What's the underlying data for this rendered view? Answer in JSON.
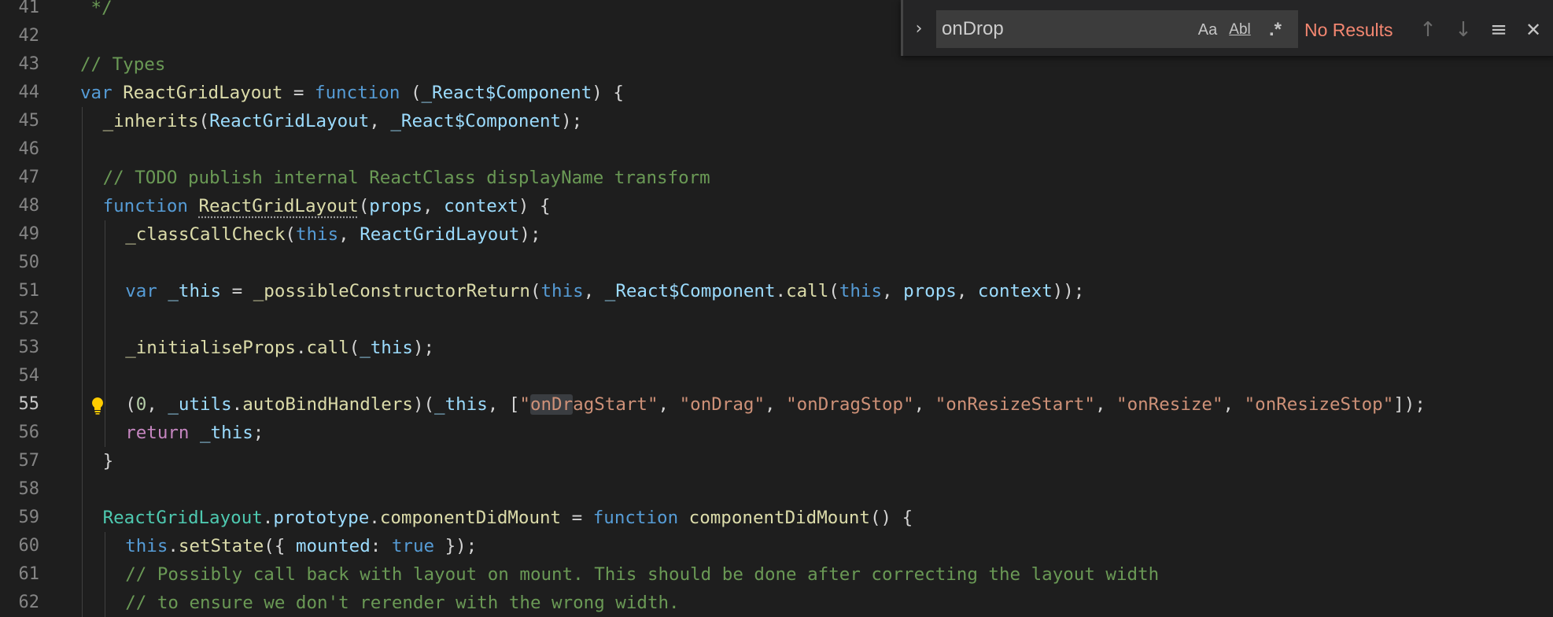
{
  "find_widget": {
    "expand_label": "›",
    "query": "onDrop",
    "match_case_label": "Aa",
    "whole_word_label": "Abl",
    "regex_label": ".*",
    "result_text": "No Results",
    "prev_label": "↑",
    "next_label": "↓",
    "selection_label": "≡",
    "close_label": "✕"
  },
  "editor": {
    "active_line": 55,
    "lines": [
      {
        "num": "41",
        "indent": 0,
        "tokens": [
          {
            "t": " */",
            "c": "comment"
          }
        ]
      },
      {
        "num": "42",
        "indent": 0,
        "tokens": []
      },
      {
        "num": "43",
        "indent": 0,
        "tokens": [
          {
            "t": "// Types",
            "c": "comment"
          }
        ]
      },
      {
        "num": "44",
        "indent": 0,
        "tokens": [
          {
            "t": "var ",
            "c": "keyword"
          },
          {
            "t": "ReactGridLayout",
            "c": "func"
          },
          {
            "t": " = ",
            "c": "plain"
          },
          {
            "t": "function",
            "c": "keyword"
          },
          {
            "t": " (",
            "c": "plain"
          },
          {
            "t": "_React$Component",
            "c": "var"
          },
          {
            "t": ") {",
            "c": "plain"
          }
        ]
      },
      {
        "num": "45",
        "indent": 1,
        "tokens": [
          {
            "t": "_inherits",
            "c": "func"
          },
          {
            "t": "(",
            "c": "plain"
          },
          {
            "t": "ReactGridLayout",
            "c": "var"
          },
          {
            "t": ", ",
            "c": "plain"
          },
          {
            "t": "_React$Component",
            "c": "var"
          },
          {
            "t": ");",
            "c": "plain"
          }
        ]
      },
      {
        "num": "46",
        "indent": 1,
        "tokens": []
      },
      {
        "num": "47",
        "indent": 1,
        "tokens": [
          {
            "t": "// TODO publish internal ReactClass displayName transform",
            "c": "comment"
          }
        ]
      },
      {
        "num": "48",
        "indent": 1,
        "tokens": [
          {
            "t": "function ",
            "c": "keyword"
          },
          {
            "t": "ReactGridLayout",
            "c": "func dotted"
          },
          {
            "t": "(",
            "c": "plain"
          },
          {
            "t": "props",
            "c": "var"
          },
          {
            "t": ", ",
            "c": "plain"
          },
          {
            "t": "context",
            "c": "var"
          },
          {
            "t": ") {",
            "c": "plain"
          }
        ]
      },
      {
        "num": "49",
        "indent": 2,
        "tokens": [
          {
            "t": "_classCallCheck",
            "c": "func"
          },
          {
            "t": "(",
            "c": "plain"
          },
          {
            "t": "this",
            "c": "keyword"
          },
          {
            "t": ", ",
            "c": "plain"
          },
          {
            "t": "ReactGridLayout",
            "c": "var"
          },
          {
            "t": ");",
            "c": "plain"
          }
        ]
      },
      {
        "num": "50",
        "indent": 2,
        "tokens": []
      },
      {
        "num": "51",
        "indent": 2,
        "tokens": [
          {
            "t": "var ",
            "c": "keyword"
          },
          {
            "t": "_this",
            "c": "var"
          },
          {
            "t": " = ",
            "c": "plain"
          },
          {
            "t": "_possibleConstructorReturn",
            "c": "func"
          },
          {
            "t": "(",
            "c": "plain"
          },
          {
            "t": "this",
            "c": "keyword"
          },
          {
            "t": ", ",
            "c": "plain"
          },
          {
            "t": "_React$Component",
            "c": "var"
          },
          {
            "t": ".",
            "c": "plain"
          },
          {
            "t": "call",
            "c": "func"
          },
          {
            "t": "(",
            "c": "plain"
          },
          {
            "t": "this",
            "c": "keyword"
          },
          {
            "t": ", ",
            "c": "plain"
          },
          {
            "t": "props",
            "c": "var"
          },
          {
            "t": ", ",
            "c": "plain"
          },
          {
            "t": "context",
            "c": "var"
          },
          {
            "t": "));",
            "c": "plain"
          }
        ]
      },
      {
        "num": "52",
        "indent": 2,
        "tokens": []
      },
      {
        "num": "53",
        "indent": 2,
        "tokens": [
          {
            "t": "_initialiseProps",
            "c": "func"
          },
          {
            "t": ".",
            "c": "plain"
          },
          {
            "t": "call",
            "c": "func"
          },
          {
            "t": "(",
            "c": "plain"
          },
          {
            "t": "_this",
            "c": "var"
          },
          {
            "t": ");",
            "c": "plain"
          }
        ]
      },
      {
        "num": "54",
        "indent": 2,
        "tokens": []
      },
      {
        "num": "55",
        "indent": 2,
        "bulb": true,
        "tokens": [
          {
            "t": "(",
            "c": "plain"
          },
          {
            "t": "0",
            "c": "number"
          },
          {
            "t": ", ",
            "c": "plain"
          },
          {
            "t": "_utils",
            "c": "var"
          },
          {
            "t": ".",
            "c": "plain"
          },
          {
            "t": "autoBindHandlers",
            "c": "func"
          },
          {
            "t": ")(",
            "c": "plain"
          },
          {
            "t": "_this",
            "c": "var"
          },
          {
            "t": ", [",
            "c": "plain"
          },
          {
            "t": "\"",
            "c": "string"
          },
          {
            "t": "onDr",
            "c": "string hl"
          },
          {
            "t": "agStart\"",
            "c": "string"
          },
          {
            "t": ", ",
            "c": "plain"
          },
          {
            "t": "\"onDrag\"",
            "c": "string"
          },
          {
            "t": ", ",
            "c": "plain"
          },
          {
            "t": "\"onDragStop\"",
            "c": "string"
          },
          {
            "t": ", ",
            "c": "plain"
          },
          {
            "t": "\"onResizeStart\"",
            "c": "string"
          },
          {
            "t": ", ",
            "c": "plain"
          },
          {
            "t": "\"onResize\"",
            "c": "string"
          },
          {
            "t": ", ",
            "c": "plain"
          },
          {
            "t": "\"onResizeStop\"",
            "c": "string"
          },
          {
            "t": "]);",
            "c": "plain"
          }
        ]
      },
      {
        "num": "56",
        "indent": 2,
        "tokens": [
          {
            "t": "return ",
            "c": "control"
          },
          {
            "t": "_this",
            "c": "var"
          },
          {
            "t": ";",
            "c": "plain"
          }
        ]
      },
      {
        "num": "57",
        "indent": 1,
        "tokens": [
          {
            "t": "}",
            "c": "plain"
          }
        ]
      },
      {
        "num": "58",
        "indent": 1,
        "tokens": []
      },
      {
        "num": "59",
        "indent": 1,
        "tokens": [
          {
            "t": "ReactGridLayout",
            "c": "class"
          },
          {
            "t": ".",
            "c": "plain"
          },
          {
            "t": "prototype",
            "c": "var"
          },
          {
            "t": ".",
            "c": "plain"
          },
          {
            "t": "componentDidMount",
            "c": "func"
          },
          {
            "t": " = ",
            "c": "plain"
          },
          {
            "t": "function",
            "c": "keyword"
          },
          {
            "t": " ",
            "c": "plain"
          },
          {
            "t": "componentDidMount",
            "c": "func"
          },
          {
            "t": "() {",
            "c": "plain"
          }
        ]
      },
      {
        "num": "60",
        "indent": 2,
        "tokens": [
          {
            "t": "this",
            "c": "keyword"
          },
          {
            "t": ".",
            "c": "plain"
          },
          {
            "t": "setState",
            "c": "func"
          },
          {
            "t": "({ ",
            "c": "plain"
          },
          {
            "t": "mounted",
            "c": "var"
          },
          {
            "t": ": ",
            "c": "plain"
          },
          {
            "t": "true",
            "c": "keyword"
          },
          {
            "t": " });",
            "c": "plain"
          }
        ]
      },
      {
        "num": "61",
        "indent": 2,
        "tokens": [
          {
            "t": "// Possibly call back with layout on mount. This should be done after correcting the layout width",
            "c": "comment"
          }
        ]
      },
      {
        "num": "62",
        "indent": 2,
        "tokens": [
          {
            "t": "// to ensure we don't rerender with the wrong width.",
            "c": "comment"
          }
        ]
      }
    ]
  },
  "icons": {
    "lightbulb": "lightbulb-icon",
    "expand": "chevron-right-icon",
    "close": "close-icon"
  },
  "colors": {
    "background": "#1e1e1e",
    "comment": "#6a9955",
    "keyword": "#569cd6",
    "string": "#ce9178",
    "function": "#dcdcaa",
    "variable": "#9cdcfe",
    "no_results": "#f48771",
    "lightbulb": "#ffcc00"
  }
}
